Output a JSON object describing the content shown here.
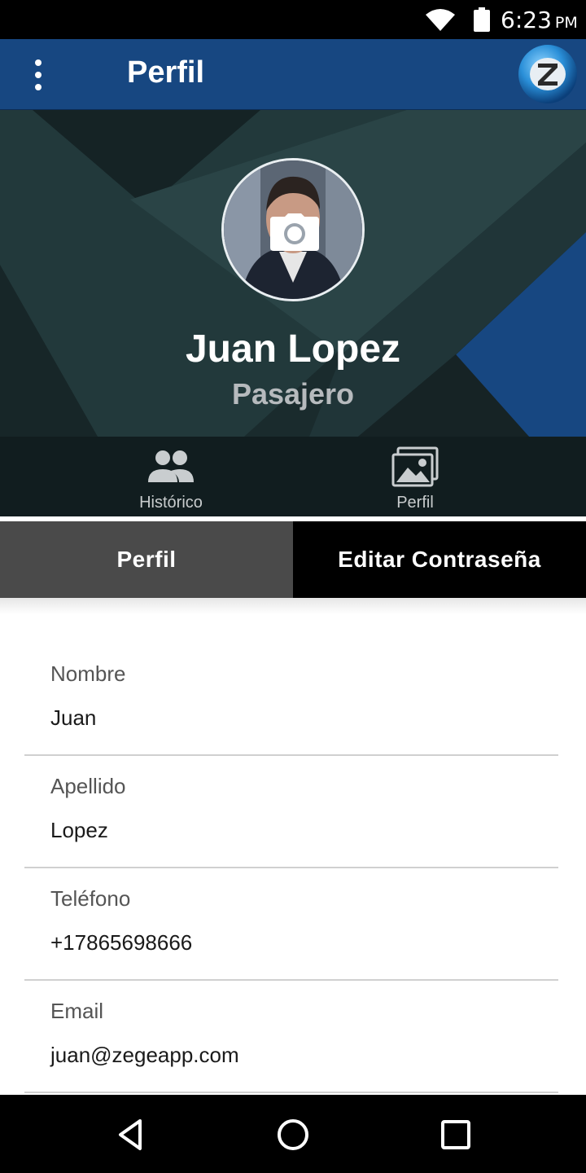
{
  "status_bar": {
    "time": "6:23",
    "ampm": "PM"
  },
  "app_bar": {
    "title": "Perfil"
  },
  "profile": {
    "name": "Juan Lopez",
    "role": "Pasajero"
  },
  "icon_tabs": [
    {
      "label": "Histórico",
      "icon": "people-icon"
    },
    {
      "label": "Perfil",
      "icon": "photos-icon"
    }
  ],
  "segments": {
    "left": "Perfil",
    "right": "Editar Contraseña"
  },
  "fields": [
    {
      "label": "Nombre",
      "value": "Juan"
    },
    {
      "label": "Apellido",
      "value": "Lopez"
    },
    {
      "label": "Teléfono",
      "value": "+17865698666"
    },
    {
      "label": "Email",
      "value": "juan@zegeapp.com"
    }
  ],
  "colors": {
    "app_bar": "#174781",
    "header_dark": "#1b2c2e",
    "accent_blue": "#174781",
    "segment_active": "#4a4a4a"
  }
}
